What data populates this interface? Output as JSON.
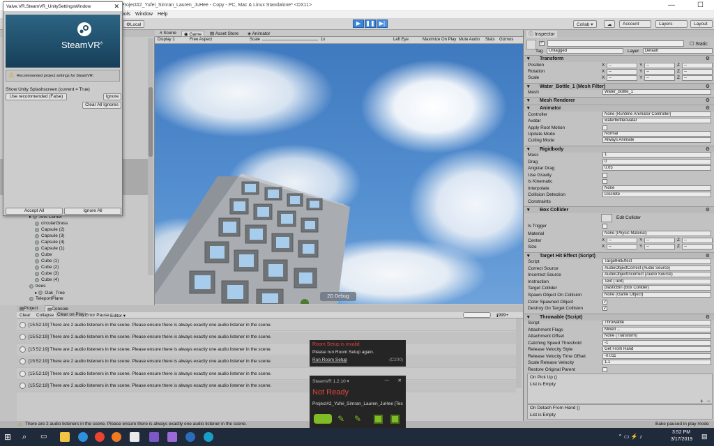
{
  "window": {
    "title": "Project#2_Yufei_Simran_Lauren_JuHee - Copy - PC, Mac & Linux Standalone* <DX11>"
  },
  "menu": {
    "tools": "ools",
    "window": "Window",
    "help": "Help"
  },
  "toolbar": {
    "local": "Local",
    "collab": "Collab ▾",
    "account": "Account",
    "layers": "Layers",
    "layout": "Layout"
  },
  "steamvr": {
    "title": "Valve.VR.SteamVR_UnitySettingsWindow",
    "brand": "SteamVR",
    "tm": "®",
    "notice": "Recommended project settings for SteamVR:",
    "setting": "Show Unity Splashscreen (current = True)",
    "use_recommended": "Use recommended (False)",
    "ignore": "Ignore",
    "clear_all_ignores": "Clear All Ignores",
    "accept_all": "Accept All",
    "ignore_all": "Ignore All"
  },
  "hierarchy": {
    "items": [
      "Arts Center",
      "circularGrass",
      "Capsule (2)",
      "Capsule (3)",
      "Capsule (4)",
      "Capsule (1)",
      "Cube",
      "Cube (1)",
      "Cube (2)",
      "Cube (3)",
      "Cube (4)",
      "trees",
      "Oak_Tree",
      "TeleportPlane",
      "Cat Lite",
      "Cat Lite"
    ]
  },
  "viewtabs": {
    "scene": "Scene",
    "game": "Game",
    "asset_store": "Asset Store",
    "animator": "Animator"
  },
  "gamebar": {
    "display": "Display 1",
    "aspect": "Free Aspect",
    "scale": "Scale",
    "scale_val": "1x",
    "eye": "Left Eye",
    "maximize": "Maximize On Play",
    "mute": "Mute Audio",
    "stats": "Stats",
    "gizmos": "Gizmos"
  },
  "debug_label": "2D Debug",
  "console": {
    "tabs": {
      "project": "Project",
      "console": "Console"
    },
    "clear": "Clear",
    "collapse": "Collapse",
    "clear_on_play": "Clear on Play",
    "error_pause": "Error Pause",
    "editor": "Editor ▾",
    "count": "999+",
    "lines": [
      "[15:52:19] There are 2 audio listeners in the scene. Please ensure there is always exactly one audio listener in the scene.",
      "[15:52:19] There are 2 audio listeners in the scene. Please ensure there is always exactly one audio listener in the scene.",
      "[15:52:19] There are 2 audio listeners in the scene. Please ensure there is always exactly one audio listener in the scene.",
      "[15:52:19] There are 2 audio listeners in the scene. Please ensure there is always exactly one audio listener in the scene.",
      "[15:52:19] There are 2 audio listeners in the scene. Please ensure there is always exactly one audio listener in the scene.",
      "[15:52:19] There are 2 audio listeners in the scene. Please ensure there is always exactly one audio listener in the scene."
    ],
    "status": "There are 2 audio listeners in the scene. Please ensure there is always exactly one audio listener in the scene."
  },
  "room_setup": {
    "title": "Room Setup is invalid",
    "msg": "Please run Room Setup again.",
    "link": "Run Room Setup",
    "code": "(C200)"
  },
  "steamvr_status": {
    "version": "SteamVR 1.2.10 ▾",
    "state": "Not Ready",
    "project": "Project#2_Yufei_Simran_Lauren_JuHee [Tes"
  },
  "inspector": {
    "tab": "Inspector",
    "static": "Static",
    "tag_label": "Tag",
    "tag": "Untagged",
    "layer_label": "Layer",
    "layer": "Default",
    "transform": "Transform",
    "position": "Position",
    "rotation": "Rotation",
    "scale": "Scale",
    "x": "X",
    "y": "Y",
    "z": "Z",
    "dash": "--",
    "mesh_filter": "Water_Bottle_1 (Mesh Filter)",
    "mesh_label": "Mesh",
    "mesh": "Water_Bottle_1",
    "mesh_renderer": "Mesh Renderer",
    "animator": "Animator",
    "controller_label": "Controller",
    "controller": "None (Runtime Animator Controller)",
    "avatar_label": "Avatar",
    "avatar": "waterbottleAvatar",
    "apply_root": "Apply Root Motion",
    "update_mode_label": "Update Mode",
    "update_mode": "Normal",
    "culling_label": "Culling Mode",
    "culling": "Always Animate",
    "rigidbody": "Rigidbody",
    "mass_label": "Mass",
    "mass": "1",
    "drag_label": "Drag",
    "drag": "0",
    "ang_drag_label": "Angular Drag",
    "ang_drag": "0.05",
    "use_gravity": "Use Gravity",
    "is_kinematic": "Is Kinematic",
    "interpolate_label": "Interpolate",
    "interpolate": "None",
    "collision_label": "Collision Detection",
    "collision": "Discrete",
    "constraints": "Constraints",
    "box_collider": "Box Collider",
    "edit_collider": "Edit Collider",
    "is_trigger": "Is Trigger",
    "material_label": "Material",
    "material": "None (Physic Material)",
    "center": "Center",
    "size": "Size",
    "target_hit": "Target Hit Effect (Script)",
    "script_label": "Script",
    "target_script": "TargetHitEffect",
    "correct_label": "Correct Source",
    "correct": "AudioObjectCorrect (Audio Source)",
    "incorrect_label": "Incorrect Source",
    "incorrect": "AudioObjectIncorrect (Audio Source)",
    "instruction_label": "Instruction",
    "instruction": "Text (Text)",
    "target_collider_label": "Target Collider",
    "target_collider": "plasticBin (Box Collider)",
    "spawn_label": "Spawn Object On Collision",
    "spawn": "None (Game Object)",
    "color_spawned": "Color Spawned Object",
    "destroy": "Destroy On Target Collision",
    "throwable": "Throwable (Script)",
    "throwable_script": "Throwable",
    "attach_flags_label": "Attachment Flags",
    "attach_flags": "Mixed ...",
    "attach_offset_label": "Attachment Offset",
    "attach_offset": "None (Transform)",
    "catching_label": "Catching Speed Threshold",
    "catching": "-1",
    "release_style_label": "Release Velocity Style",
    "release_style": "Get From Hand",
    "release_time_label": "Release Velocity Time Offset",
    "release_time": "-0.011",
    "scale_rel_label": "Scale Release Velocity",
    "scale_rel": "1.1",
    "restore_label": "Restore Original Parent",
    "on_pickup": "On Pick Up ()",
    "list_empty": "List is Empty",
    "on_detach": "On Detach From Hand ()",
    "list_empty2": "List is Empty",
    "bake": "Bake paused in play mode"
  },
  "taskbar": {
    "time": "3:52 PM",
    "date": "3/17/2019"
  }
}
